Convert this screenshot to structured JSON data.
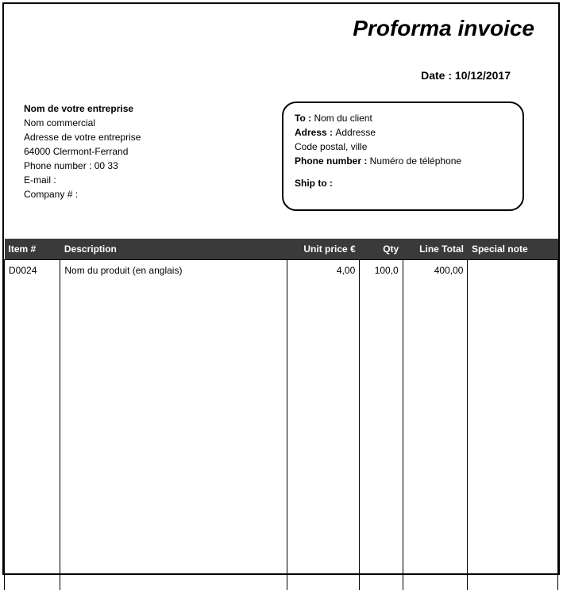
{
  "title": "Proforma invoice",
  "date_label": "Date : ",
  "date_value": "10/12/2017",
  "sender": {
    "name": "Nom de votre entreprise",
    "commercial_name": "Nom commercial",
    "address": "Adresse de votre entreprise",
    "city": "64000 Clermont-Ferrand",
    "phone_label": "Phone number : ",
    "phone_value": "00 33",
    "email_label": "E-mail :",
    "company_no_label": "Company # :"
  },
  "recipient": {
    "to_label": "To : ",
    "to_value": "Nom du client",
    "address_label": "Adress : ",
    "address_value": "Addresse",
    "city_value": "Code postal, ville",
    "phone_label": "Phone number : ",
    "phone_value": "Numéro de téléphone",
    "ship_to_label": "Ship to :"
  },
  "table": {
    "headers": {
      "item": "Item #",
      "description": "Description",
      "unit_price": "Unit price €",
      "qty": "Qty",
      "line_total": "Line Total",
      "special_note": "Special note"
    },
    "rows": [
      {
        "item": "D0024",
        "description": "Nom du produit (en anglais)",
        "unit_price": "4,00",
        "qty": "100,0",
        "line_total": "400,00",
        "special_note": ""
      }
    ]
  }
}
